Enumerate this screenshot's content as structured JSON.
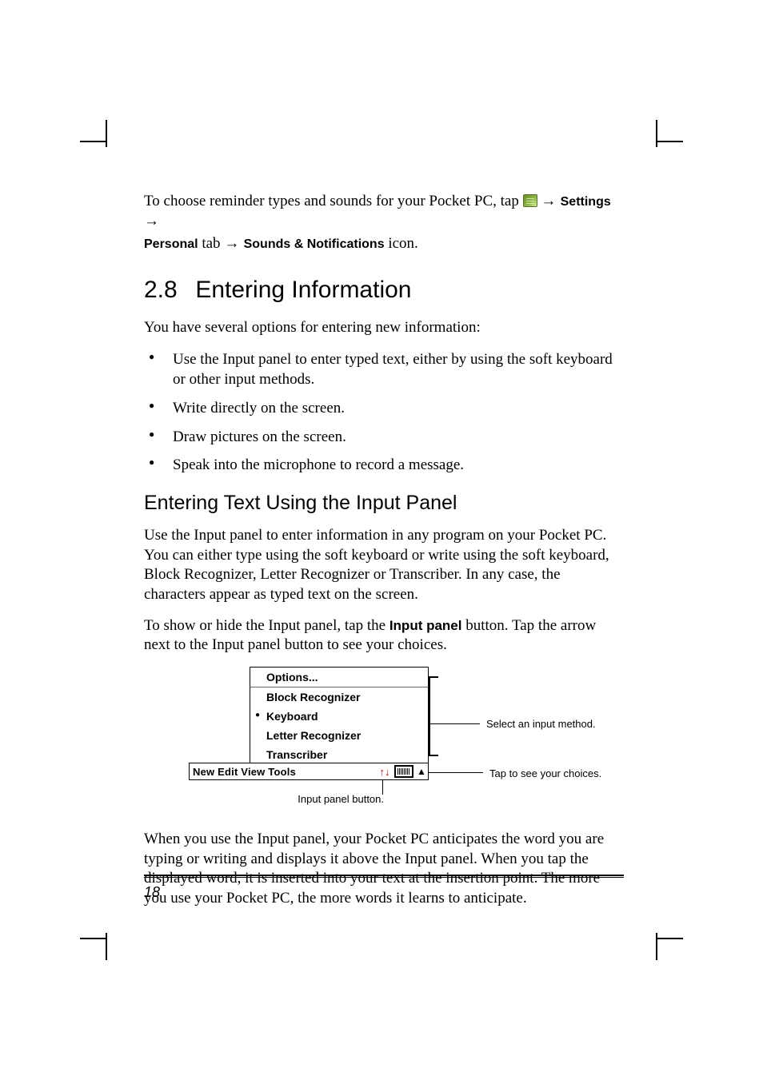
{
  "intro": {
    "prefix": "To choose reminder types and sounds for your Pocket PC, tap ",
    "arrow": " → ",
    "settings": "Settings",
    "personal_tab": "Personal",
    "tab_word": " tab ",
    "sounds": "Sounds & Notifications",
    "icon_word": " icon."
  },
  "section": {
    "number": "2.8",
    "title": "Entering Information"
  },
  "lead_para": "You have several options for entering new information:",
  "bullets": [
    "Use the Input panel to enter typed text, either by using the soft keyboard or other input methods.",
    "Write directly on the screen.",
    "Draw pictures on the screen.",
    "Speak into the microphone to record a message."
  ],
  "subsection": "Entering Text Using the Input Panel",
  "sub_para1": "Use the Input panel to enter information in any program on your Pocket PC. You can either type using the soft keyboard or write using the soft keyboard, Block Recognizer, Letter Recognizer or Transcriber. In any case, the characters appear as typed text on the screen.",
  "sub_para2_a": "To show or hide the Input panel, tap the ",
  "sub_para2_bold": "Input panel",
  "sub_para2_b": " button. Tap the arrow next to the Input panel button to see your choices.",
  "popup": {
    "options": "Options...",
    "items": [
      "Block Recognizer",
      "Keyboard",
      "Letter Recognizer",
      "Transcriber"
    ],
    "selected_index": 1
  },
  "menubar": {
    "items": "New Edit View Tools",
    "updown_glyph": "↑↓"
  },
  "callouts": {
    "select": "Select an input method.",
    "tap": "Tap to see your choices.",
    "button": "Input panel button."
  },
  "closing_para": "When you use the Input panel, your Pocket PC anticipates the word you are typing or writing and displays it above the Input panel. When you tap the displayed word, it is inserted into your text at the insertion point. The more you use your Pocket PC, the more words it learns to anticipate.",
  "page_number": "18"
}
